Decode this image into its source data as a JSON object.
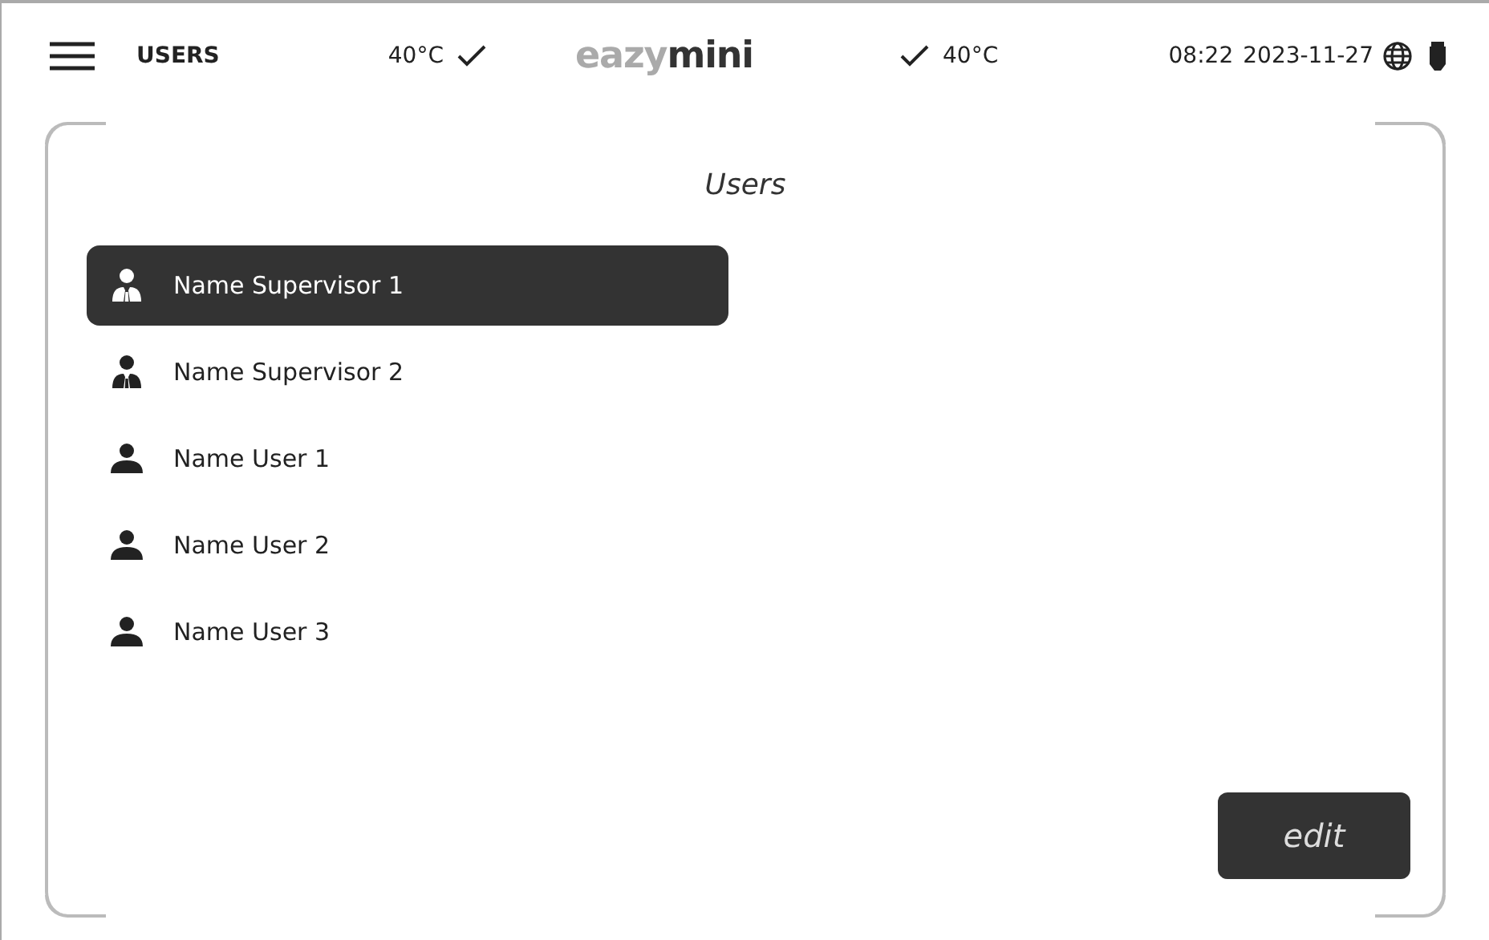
{
  "header": {
    "title": "USERS",
    "temp_left": "40°C",
    "temp_right": "40°C",
    "logo_light": "eazy",
    "logo_bold": "mini",
    "time": "08:22",
    "date": "2023-11-27"
  },
  "panel": {
    "title": "Users"
  },
  "users": [
    {
      "name": "Name Supervisor 1",
      "kind": "supervisor",
      "selected": true
    },
    {
      "name": "Name Supervisor 2",
      "kind": "supervisor",
      "selected": false
    },
    {
      "name": "Name User 1",
      "kind": "user",
      "selected": false
    },
    {
      "name": "Name User 2",
      "kind": "user",
      "selected": false
    },
    {
      "name": "Name User 3",
      "kind": "user",
      "selected": false
    }
  ],
  "buttons": {
    "edit": "edit"
  }
}
